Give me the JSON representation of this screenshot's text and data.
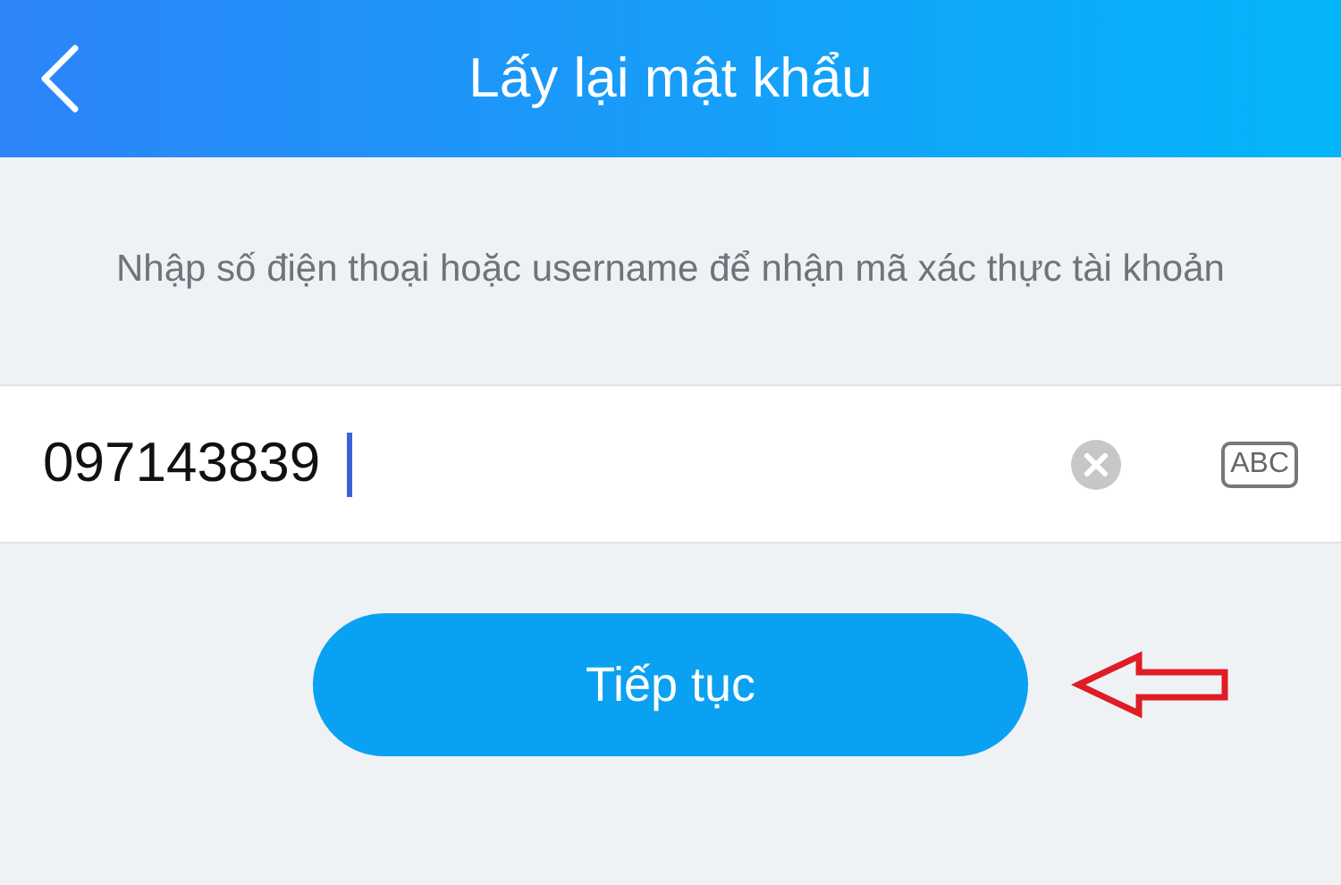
{
  "header": {
    "title": "Lấy lại mật khẩu"
  },
  "instruction": "Nhập số điện thoại hoặc username để nhận mã xác thực tài khoản",
  "phone_field": {
    "value": "097143839",
    "keyboard_toggle": "ABC"
  },
  "continue_button": "Tiếp tục"
}
